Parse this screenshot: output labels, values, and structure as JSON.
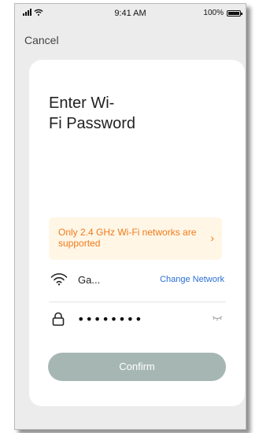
{
  "status_bar": {
    "time": "9:41 AM",
    "battery": "100%"
  },
  "nav": {
    "cancel_label": "Cancel"
  },
  "page": {
    "title_line1": "Enter Wi-",
    "title_line2": "Fi Password"
  },
  "notice": {
    "text": "Only 2.4 GHz Wi-Fi networks are supported",
    "arrow": "›",
    "color": "#f07a1a",
    "background": "#fff6e6"
  },
  "network": {
    "name": "Ga...",
    "change_label": "Change Network",
    "icon": "wifi-icon"
  },
  "password": {
    "value": "••••••••",
    "icon": "lock-icon",
    "visibility_icon": "eye-closed-icon"
  },
  "confirm": {
    "label": "Confirm",
    "color": "#a6b7b3"
  },
  "colors": {
    "link": "#2a6fd6",
    "background": "#ececec",
    "card": "#ffffff"
  }
}
